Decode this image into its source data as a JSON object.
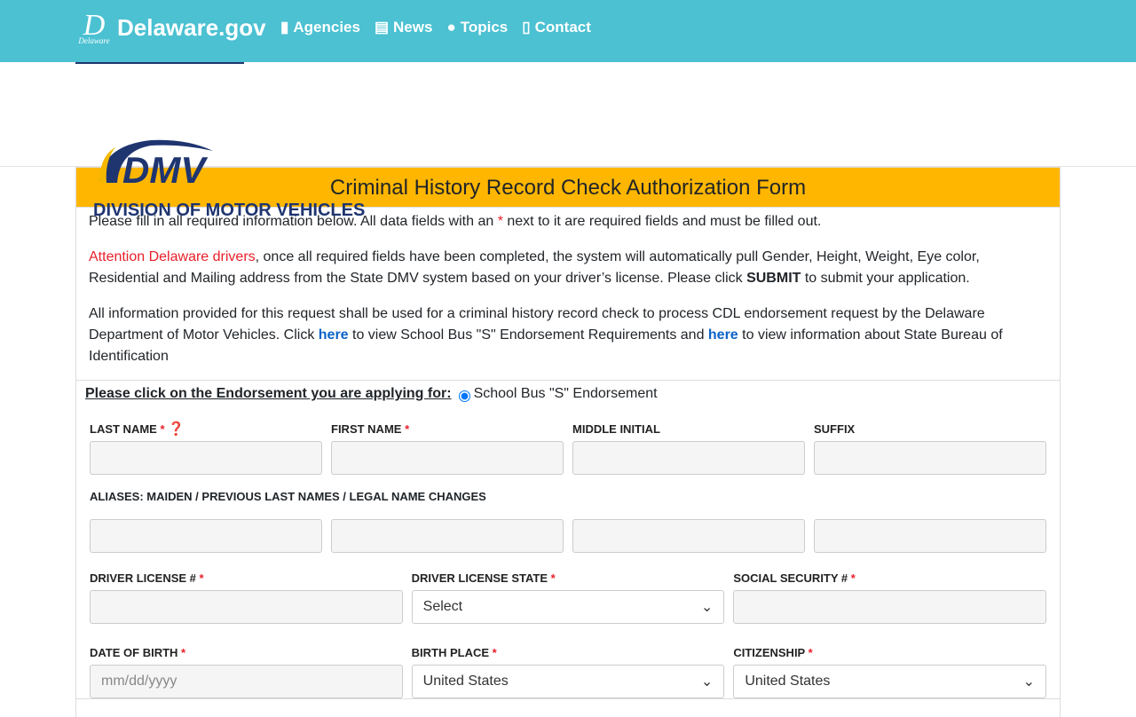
{
  "topbar": {
    "brand": "Delaware.gov",
    "seal_big": "D",
    "seal_small": "Delaware",
    "nav": [
      {
        "label": "Agencies",
        "icon": "building-icon"
      },
      {
        "label": "News",
        "icon": "newspaper-icon"
      },
      {
        "label": "Topics",
        "icon": "comments-icon"
      },
      {
        "label": "Contact",
        "icon": "mobile-icon"
      }
    ]
  },
  "header": {
    "logo_text": "DMV",
    "division": "DIVISION OF MOTOR VEHICLES"
  },
  "form": {
    "title": "Criminal History Record Check Authorization Form",
    "p1a": "Please fill in all required information below. All data fields with an ",
    "p1star": "*",
    "p1b": " next to it are required fields and must be filled out.",
    "p2red": "Attention Delaware drivers",
    "p2a": ", once all required fields have been completed, the system will automatically pull Gender, Height, Weight, Eye color, Residential and Mailing address from the State DMV system based on your driver’s license. Please click ",
    "p2bold": "SUBMIT",
    "p2b": " to submit your application.",
    "p3a": "All information provided for this request shall be used for a criminal history record check to process CDL endorsement request by the Delaware Department of Motor Vehicles. Click ",
    "here": "here",
    "p3b": " to view School Bus \"S\" Endorsement Requirements and ",
    "p3c": " to view information about State Bureau of Identification",
    "endorse_label": "Please click on the Endorsement you are applying for:",
    "endorse_option": "School Bus \"S\" Endorsement",
    "star": "*",
    "labels": {
      "last": "LAST NAME",
      "first": "FIRST NAME",
      "middle": "MIDDLE INITIAL",
      "suffix": "SUFFIX",
      "aliases": "ALIASES: MAIDEN / PREVIOUS LAST NAMES / LEGAL NAME CHANGES",
      "dl": "DRIVER LICENSE #",
      "dlstate": "DRIVER LICENSE STATE",
      "ssn": "SOCIAL SECURITY #",
      "dob": "DATE OF BIRTH",
      "birthplace": "BIRTH PLACE",
      "citizenship": "CITIZENSHIP"
    },
    "values": {
      "dlstate": "Select",
      "dob_placeholder": "mm/dd/yyyy",
      "birthplace": "United States",
      "citizenship": "United States"
    }
  }
}
